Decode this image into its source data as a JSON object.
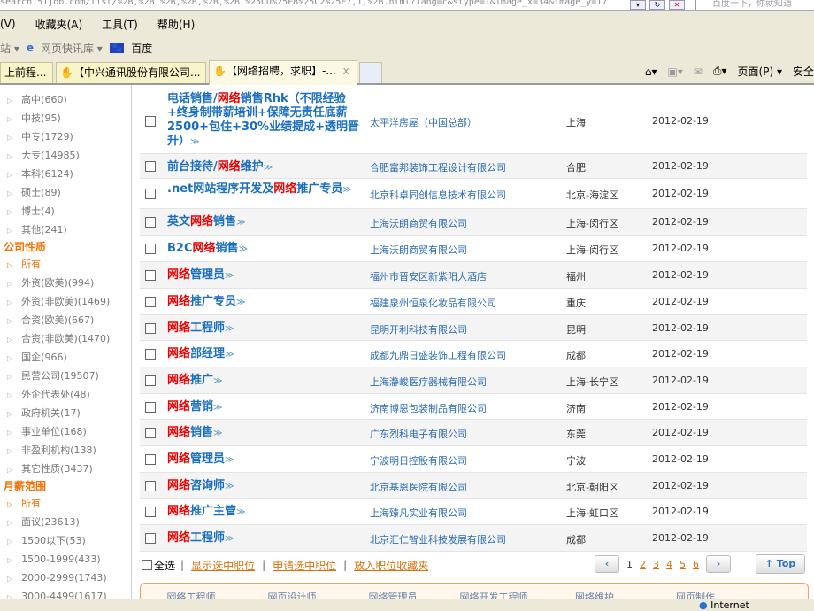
{
  "browser": {
    "url": "search.51job.com/list/%2B,%2B,%2B,%2B,%2B,%2B,%25CD%25F8%25C2%25E7,1,%2B.html?lang=c&stype=1&image_x=34&image_y=17",
    "search_placeholder": "百度一下，你就知道",
    "menu": [
      "(V)",
      "收藏夹(A)",
      "工具(T)",
      "帮助(H)"
    ],
    "links": [
      "站 ▾",
      "网页快讯库 ▾",
      "百度"
    ],
    "tabs": [
      "上前程...",
      "【中兴通讯股份有限公司...",
      "【网络招聘，求职】-..."
    ],
    "tab_close": "x",
    "tools": [
      "页面(P) ▾",
      "安全"
    ],
    "status_zone": "Internet"
  },
  "sidebar": {
    "education": [
      {
        "label": "高中",
        "count": "(660)"
      },
      {
        "label": "中技",
        "count": "(95)"
      },
      {
        "label": "中专",
        "count": "(1729)"
      },
      {
        "label": "大专",
        "count": "(14985)"
      },
      {
        "label": "本科",
        "count": "(6124)"
      },
      {
        "label": "硕士",
        "count": "(89)"
      },
      {
        "label": "博士",
        "count": "(4)"
      },
      {
        "label": "其他",
        "count": "(241)"
      }
    ],
    "company_type_head": "公司性质",
    "company_type": [
      {
        "label": "所有",
        "count": ""
      },
      {
        "label": "外资(欧美)",
        "count": "(994)"
      },
      {
        "label": "外资(非欧美)",
        "count": "(1469)"
      },
      {
        "label": "合资(欧美)",
        "count": "(667)"
      },
      {
        "label": "合资(非欧美)",
        "count": "(1470)"
      },
      {
        "label": "国企",
        "count": "(966)"
      },
      {
        "label": "民营公司",
        "count": "(19507)"
      },
      {
        "label": "外企代表处",
        "count": "(48)"
      },
      {
        "label": "政府机关",
        "count": "(17)"
      },
      {
        "label": "事业单位",
        "count": "(168)"
      },
      {
        "label": "非盈利机构",
        "count": "(138)"
      },
      {
        "label": "其它性质",
        "count": "(3437)"
      }
    ],
    "salary_head": "月薪范围",
    "salary": [
      {
        "label": "所有",
        "count": ""
      },
      {
        "label": "面议",
        "count": "(23613)"
      },
      {
        "label": "1500以下",
        "count": "(53)"
      },
      {
        "label": "1500-1999",
        "count": "(433)"
      },
      {
        "label": "2000-2999",
        "count": "(1743)"
      },
      {
        "label": "3000-4499",
        "count": "(1617)"
      }
    ]
  },
  "jobs": [
    {
      "pre": "电话销售/",
      "kw": "网络",
      "post": "销售Rhk（不限经验+终身制带薪培训+保障无责任底薪2500+包住+30%业绩提成+透明晋升）",
      "company": "太平洋房屋（中国总部）",
      "city": "上海",
      "date": "2012-02-19"
    },
    {
      "pre": "前台接待/",
      "kw": "网络",
      "post": "维护",
      "company": "合肥富邦装饰工程设计有限公司",
      "city": "合肥",
      "date": "2012-02-19"
    },
    {
      "pre": ".net网站程序开发及",
      "kw": "网络",
      "post": "推广专员",
      "company": "北京科卓同创信息技术有限公司",
      "city": "北京-海淀区",
      "date": "2012-02-19"
    },
    {
      "pre": "英文",
      "kw": "网络",
      "post": "销售",
      "company": "上海沃朗商贸有限公司",
      "city": "上海-闵行区",
      "date": "2012-02-19"
    },
    {
      "pre": "B2C",
      "kw": "网络",
      "post": "销售",
      "company": "上海沃朗商贸有限公司",
      "city": "上海-闵行区",
      "date": "2012-02-19"
    },
    {
      "pre": "",
      "kw": "网络",
      "post": "管理员",
      "company": "福州市晋安区新紫阳大酒店",
      "city": "福州",
      "date": "2012-02-19"
    },
    {
      "pre": "",
      "kw": "网络",
      "post": "推广专员",
      "company": "福建泉州恒泉化妆品有限公司",
      "city": "重庆",
      "date": "2012-02-19"
    },
    {
      "pre": "",
      "kw": "网络",
      "post": "工程师",
      "company": "昆明开利科技有限公司",
      "city": "昆明",
      "date": "2012-02-19"
    },
    {
      "pre": "",
      "kw": "网络",
      "post": "部经理",
      "company": "成都九鼎日盛装饰工程有限公司",
      "city": "成都",
      "date": "2012-02-19"
    },
    {
      "pre": "",
      "kw": "网络",
      "post": "推广",
      "company": "上海瀞峻医疗器械有限公司",
      "city": "上海-长宁区",
      "date": "2012-02-19"
    },
    {
      "pre": "",
      "kw": "网络",
      "post": "营销",
      "company": "济南博恩包装制品有限公司",
      "city": "济南",
      "date": "2012-02-19"
    },
    {
      "pre": "",
      "kw": "网络",
      "post": "销售",
      "company": "广东烈科电子有限公司",
      "city": "东莞",
      "date": "2012-02-19"
    },
    {
      "pre": "",
      "kw": "网络",
      "post": "管理员",
      "company": "宁波明日控股有限公司",
      "city": "宁波",
      "date": "2012-02-19"
    },
    {
      "pre": "",
      "kw": "网络",
      "post": "咨询师",
      "company": "北京基恩医院有限公司",
      "city": "北京-朝阳区",
      "date": "2012-02-19"
    },
    {
      "pre": "",
      "kw": "网络",
      "post": "推广主管",
      "company": "上海臻凡实业有限公司",
      "city": "上海-虹口区",
      "date": "2012-02-19"
    },
    {
      "pre": "",
      "kw": "网络",
      "post": "工程师",
      "company": "北京汇仁智业科技发展有限公司",
      "city": "成都",
      "date": "2012-02-19"
    }
  ],
  "more_icon": "≫",
  "footer": {
    "select_all": "全选",
    "sep": "|",
    "actions": [
      "显示选中职位",
      "申请选中职位",
      "放入职位收藏夹"
    ]
  },
  "pager": {
    "prev": "‹",
    "pages": [
      "1",
      "2",
      "3",
      "4",
      "5",
      "6"
    ],
    "current": "1",
    "next": "›",
    "top": "Top"
  },
  "related": [
    "网络工程师",
    "网页设计师",
    "网络管理员",
    "网络开发工程师",
    "网络维护",
    "网页制作"
  ],
  "colors": {
    "keyword": "#ee0000",
    "title": "#1a6ec0",
    "company": "#2c6db3",
    "accent": "#f07000",
    "link": "#d9720b"
  }
}
